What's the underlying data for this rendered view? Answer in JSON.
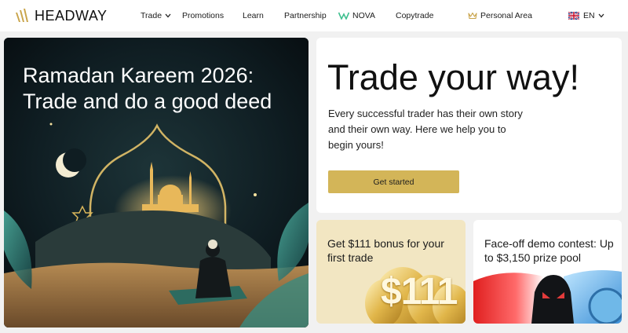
{
  "brand": {
    "name": "HEADWAY"
  },
  "nav": {
    "trade": "Trade",
    "promotions": "Promotions",
    "learn": "Learn",
    "partnership": "Partnership",
    "nova": "NOVA",
    "copytrade": "Copytrade",
    "personal_area": "Personal Area",
    "language": "EN"
  },
  "hero": {
    "title": "Ramadan Kareem 2026: Trade and do a good deed"
  },
  "main_card": {
    "headline": "Trade your way!",
    "subtext": "Every successful trader has their own story and their own way. Here we help you to begin yours!",
    "cta": "Get started"
  },
  "promos": {
    "bonus": {
      "title": "Get $111 bonus for your first trade",
      "coin_text": "$111"
    },
    "contest": {
      "title": "Face-off demo contest: Up to $3,150 prize pool"
    }
  },
  "colors": {
    "accent_gold": "#d3b558",
    "nova_green": "#3fbf8f",
    "background": "#f1f1f1"
  },
  "icons": {
    "logo": "headway-logo-mark",
    "trade_dropdown": "chevron-down-icon",
    "nova": "nova-logo-icon",
    "personal_area": "crown-icon",
    "language_flag": "uk-flag-icon",
    "language_dropdown": "chevron-down-icon"
  }
}
